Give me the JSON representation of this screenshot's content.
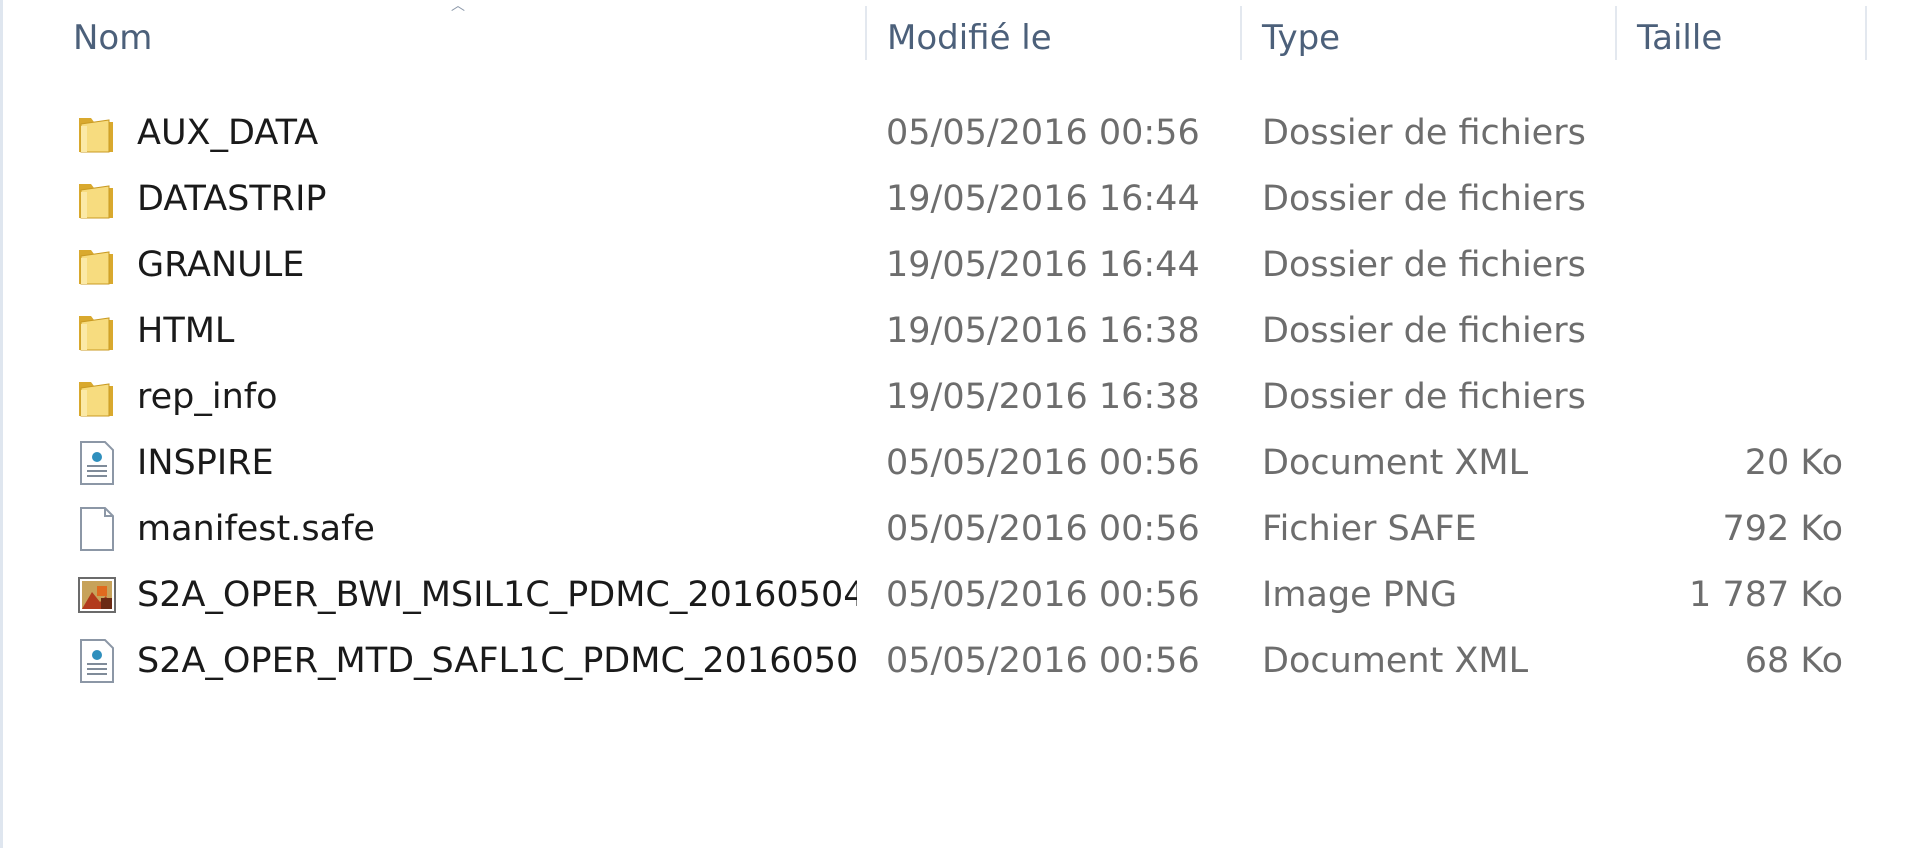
{
  "columns": {
    "name": "Nom",
    "modified": "Modifié le",
    "type": "Type",
    "size": "Taille"
  },
  "files": [
    {
      "name": "AUX_DATA",
      "modified": "05/05/2016 00:56",
      "type": "Dossier de fichiers",
      "size": "",
      "icon": "folder-icon"
    },
    {
      "name": "DATASTRIP",
      "modified": "19/05/2016 16:44",
      "type": "Dossier de fichiers",
      "size": "",
      "icon": "folder-icon"
    },
    {
      "name": "GRANULE",
      "modified": "19/05/2016 16:44",
      "type": "Dossier de fichiers",
      "size": "",
      "icon": "folder-icon"
    },
    {
      "name": "HTML",
      "modified": "19/05/2016 16:38",
      "type": "Dossier de fichiers",
      "size": "",
      "icon": "folder-icon"
    },
    {
      "name": "rep_info",
      "modified": "19/05/2016 16:38",
      "type": "Dossier de fichiers",
      "size": "",
      "icon": "folder-icon"
    },
    {
      "name": "INSPIRE",
      "modified": "05/05/2016 00:56",
      "type": "Document XML",
      "size": "20 Ko",
      "icon": "xml-document-icon"
    },
    {
      "name": "manifest.safe",
      "modified": "05/05/2016 00:56",
      "type": "Fichier SAFE",
      "size": "792 Ko",
      "icon": "blank-file-icon"
    },
    {
      "name": "S2A_OPER_BWI_MSIL1C_PDMC_20160504...",
      "modified": "05/05/2016 00:56",
      "type": "Image PNG",
      "size": "1 787 Ko",
      "icon": "png-image-icon"
    },
    {
      "name": "S2A_OPER_MTD_SAFL1C_PDMC_2016050...",
      "modified": "05/05/2016 00:56",
      "type": "Document XML",
      "size": "68 Ko",
      "icon": "xml-document-icon"
    }
  ],
  "colors": {
    "folder_light": "#f7dc7f",
    "folder_dark": "#d9a92e",
    "text": "#1a1a1a",
    "meta_text": "#6d6d6d",
    "header_text": "#4c607a"
  }
}
